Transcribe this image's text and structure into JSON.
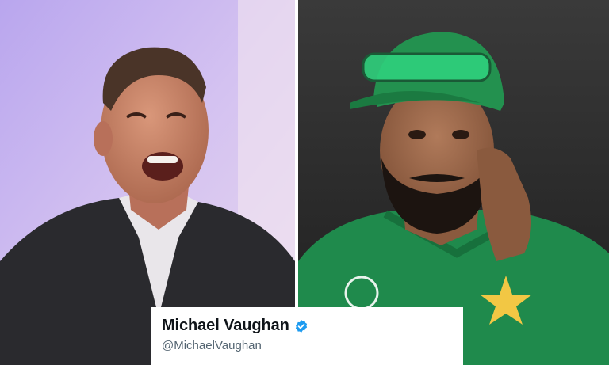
{
  "tweet_card": {
    "name": "Michael Vaughan",
    "handle": "@MichaelVaughan",
    "verified_icon": "verified-badge-icon",
    "verified_color": "#1d9bf0",
    "name_color": "#0f1419",
    "handle_color": "#536471"
  },
  "photos": {
    "left": {
      "icon": "laughing-man-photo",
      "background": "#c9b5ec"
    },
    "right": {
      "icon": "cricketer-green-cap-photo",
      "background": "#2a2a2a",
      "kit_color": "#1f8a4c",
      "star_color": "#f2c744"
    }
  }
}
